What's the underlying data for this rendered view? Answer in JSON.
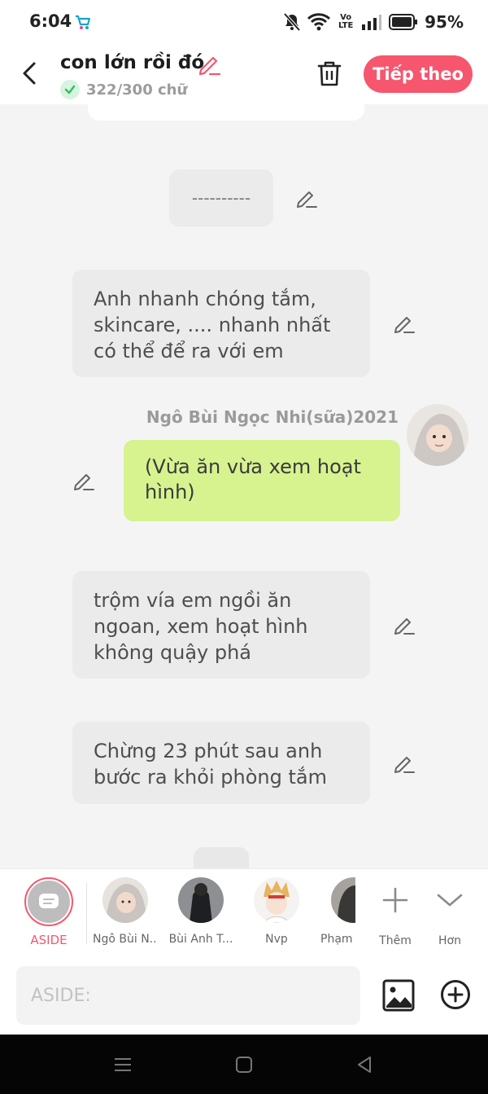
{
  "status_bar": {
    "time": "6:04",
    "network": "Vo LTE",
    "battery": "95%"
  },
  "header": {
    "title": "con lớn rồi đó",
    "word_count": "322/300 chữ",
    "next_button": "Tiếp theo",
    "accent": "#f6566e"
  },
  "messages": [
    {
      "type": "separator",
      "text": "----------"
    },
    {
      "type": "narration",
      "text": "Anh nhanh chóng tắm, skincare, .... nhanh nhất có thể để ra với em"
    },
    {
      "type": "character",
      "sender": "Ngô Bùi Ngọc Nhi(sữa)2021",
      "text": "(Vừa ăn vừa xem hoạt hình)",
      "bubble_color": "#d6f38f"
    },
    {
      "type": "narration",
      "text": "trộm vía em ngồi ăn ngoan, xem hoạt hình không quậy phá"
    },
    {
      "type": "narration",
      "text": "Chừng 23 phút sau anh bước ra khỏi phòng tắm"
    }
  ],
  "characters": {
    "aside_label": "ASIDE",
    "items": [
      {
        "name": "Ngô Bùi N..."
      },
      {
        "name": "Bùi Anh T..."
      },
      {
        "name": "Nvp"
      },
      {
        "name": "Phạm"
      }
    ],
    "add_label": "Thêm",
    "more_label": "Hơn"
  },
  "composer": {
    "placeholder": "ASIDE:"
  }
}
